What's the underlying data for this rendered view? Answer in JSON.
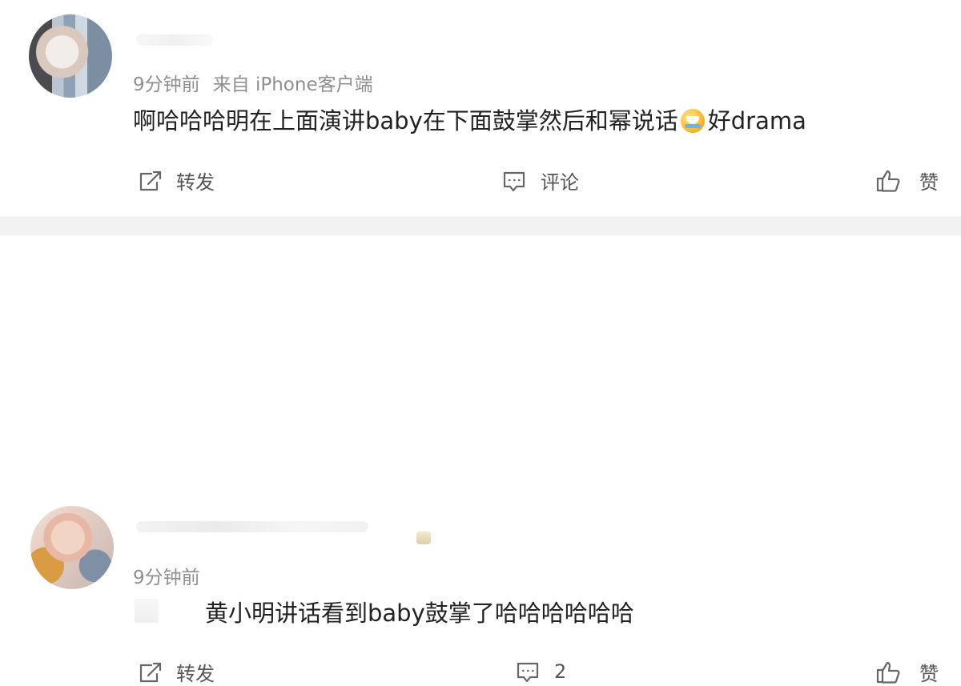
{
  "posts": [
    {
      "meta": {
        "time": "9分钟前",
        "source": "来自 iPhone客户端"
      },
      "content": {
        "main": "啊哈哈哈明在上面演讲baby在下面鼓掌然后和幂说话",
        "tail": "好drama"
      },
      "actions": {
        "repost": "转发",
        "comment": "评论",
        "like": "赞"
      }
    },
    {
      "meta": {
        "time": "9分钟前"
      },
      "content": {
        "main": "黄小明讲话看到baby鼓掌了哈哈哈哈哈哈"
      },
      "actions": {
        "repost": "转发",
        "comment_count": "2",
        "like": "赞"
      }
    }
  ],
  "colors": {
    "background": "#ffffff",
    "divider": "#f2f2f2",
    "meta_text": "#8f8f8f",
    "content_text": "#222222",
    "action_text": "#555555",
    "icon": "#666666"
  },
  "icons": {
    "repost": "repost-icon",
    "comment": "comment-icon",
    "like": "thumbs-up-icon",
    "emoji": "laughing-tears-emoji-icon"
  }
}
